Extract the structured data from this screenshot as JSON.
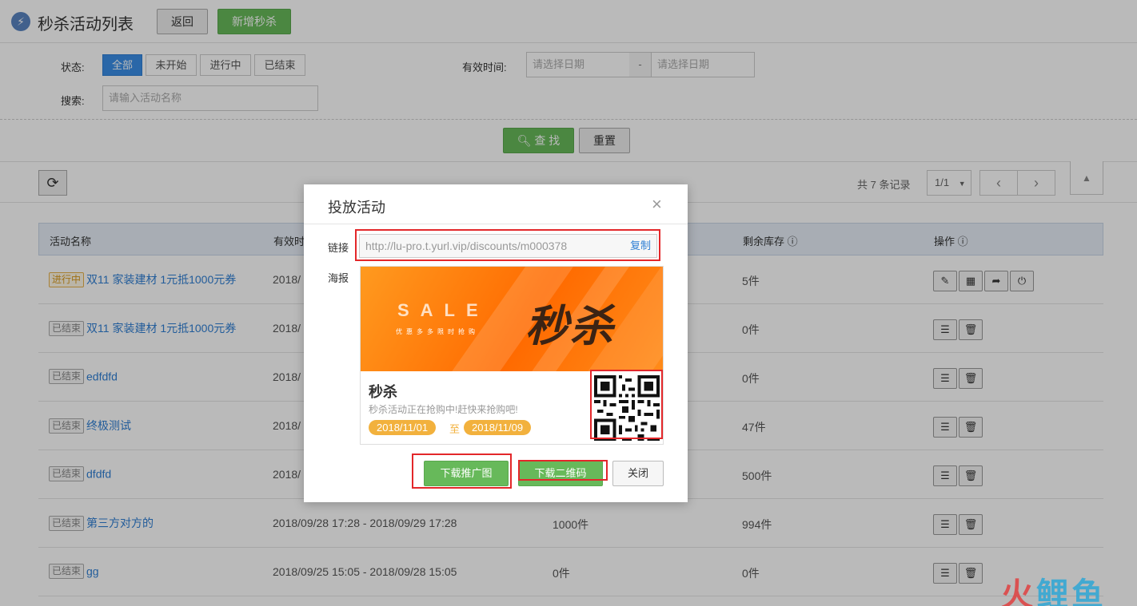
{
  "header": {
    "title": "秒杀活动列表",
    "back_label": "返回",
    "new_label": "新增秒杀"
  },
  "filters": {
    "status_label": "状态:",
    "status_options": [
      "全部",
      "未开始",
      "进行中",
      "已结束"
    ],
    "selected_status": "全部",
    "valid_time_label": "有效时间:",
    "date_start_placeholder": "请选择日期",
    "date_separator": "-",
    "date_end_placeholder": "请选择日期",
    "search_label": "搜索:",
    "search_placeholder": "请输入活动名称"
  },
  "search_bar": {
    "find_label": "查 找",
    "reset_label": "重置"
  },
  "toolbar": {
    "record_count": "共 7 条记录",
    "page": "1/1"
  },
  "table": {
    "headers": {
      "name": "活动名称",
      "time": "有效时",
      "stock": "剩余库存",
      "ops": "操作"
    },
    "rows": [
      {
        "status": "进行中",
        "name": "双11 家装建材 1元抵1000元券",
        "time": "2018/",
        "total": "",
        "stock": "5件"
      },
      {
        "status": "已结束",
        "name": "双11 家装建材 1元抵1000元券",
        "time": "2018/",
        "total": "",
        "stock": "0件"
      },
      {
        "status": "已结束",
        "name": "edfdfd",
        "time": "2018/",
        "total": "",
        "stock": "0件"
      },
      {
        "status": "已结束",
        "name": "终极测试",
        "time": "2018/",
        "total": "",
        "stock": "47件"
      },
      {
        "status": "已结束",
        "name": "dfdfd",
        "time": "2018/",
        "total": "",
        "stock": "500件"
      },
      {
        "status": "已结束",
        "name": "第三方对方的",
        "time": "2018/09/28 17:28 - 2018/09/29 17:28",
        "total": "1000件",
        "stock": "994件"
      },
      {
        "status": "已结束",
        "name": "gg",
        "time": "2018/09/25 15:05 - 2018/09/28 15:05",
        "total": "0件",
        "stock": "0件"
      }
    ]
  },
  "modal": {
    "title": "投放活动",
    "close_symbol": "×",
    "link_label": "链接",
    "link_value": "http://lu-pro.t.yurl.vip/discounts/m000378",
    "copy_label": "复制",
    "poster_label": "海报",
    "poster": {
      "sale_text": "SALE",
      "sale_sub": "优惠多多限时抢购",
      "big_title": "秒杀",
      "name": "秒杀",
      "desc": "秒杀活动正在抢购中!赶快来抢购吧!",
      "start_date": "2018/11/01",
      "to_label": "至",
      "end_date": "2018/11/09"
    },
    "download_poster_label": "下载推广图",
    "download_qr_label": "下载二维码",
    "close_label": "关闭"
  },
  "watermark": {
    "part1": "火",
    "part2": "鲤",
    "part3": "鱼"
  },
  "colors": {
    "accent_blue": "#3a8ee6",
    "green": "#67b95a",
    "highlight_red": "#e3272a",
    "poster_orange": "#ff6a00"
  }
}
